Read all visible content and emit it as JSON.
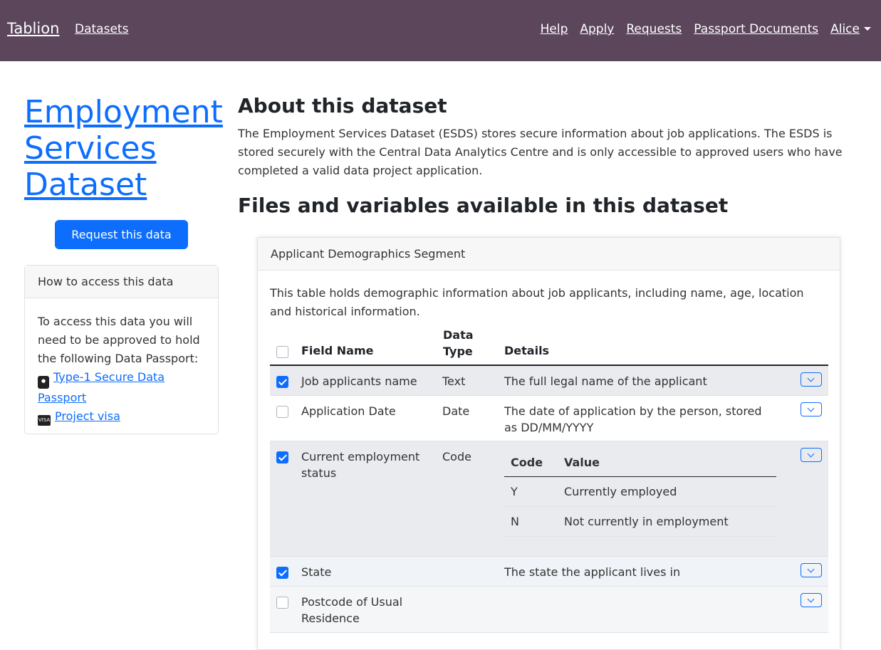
{
  "nav": {
    "brand": "Tablion",
    "datasets": "Datasets",
    "help": "Help",
    "apply": "Apply",
    "requests": "Requests",
    "passport_documents": "Passport Documents",
    "user": "Alice"
  },
  "sidebar": {
    "title": "Employment Services Dataset",
    "request_button": "Request this data",
    "access_card": {
      "header": "How to access this data",
      "intro": "To access this data you will need to be approved to hold the following Data Passport:",
      "passport_link": "Type-1 Secure Data Passport",
      "visa_icon_text": "VISA",
      "visa_link": "Project visa"
    }
  },
  "main": {
    "about_heading": "About this dataset",
    "about_text": "The Employment Services Dataset (ESDS) stores secure information about job applications. The ESDS is stored securely with the Central Data Analytics Centre and is only accessible to approved users who have completed a valid data project application.",
    "files_heading": "Files and variables available in this dataset",
    "segment": {
      "header": "Applicant Demographics Segment",
      "description": "This table holds demographic information about job applicants, including name, age, location and historical information.",
      "columns": {
        "field_name": "Field Name",
        "data_type": "Data Type",
        "details": "Details"
      },
      "rows": [
        {
          "name": "Job applicants name",
          "type": "Text",
          "details": "The full legal name of the applicant",
          "checked": true
        },
        {
          "name": "Application Date",
          "type": "Date",
          "details": "The date of application by the person, stored as DD/MM/YYYY",
          "checked": false
        },
        {
          "name": "Current employment status",
          "type": "Code",
          "details": "",
          "checked": true,
          "code_table": {
            "code_header": "Code",
            "value_header": "Value",
            "items": [
              {
                "code": "Y",
                "value": "Currently employed"
              },
              {
                "code": "N",
                "value": "Not currently in employment"
              }
            ]
          }
        },
        {
          "name": "State",
          "type": "",
          "details": "The state the applicant lives in",
          "checked": true
        },
        {
          "name": "Postcode of Usual Residence",
          "type": "",
          "details": "",
          "checked": false
        }
      ]
    }
  }
}
